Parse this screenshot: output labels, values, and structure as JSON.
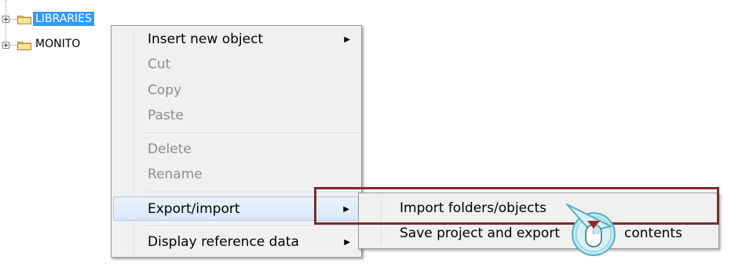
{
  "tree": {
    "items": [
      {
        "label": "LIBRARIES",
        "selected": true
      },
      {
        "label": "MONITO",
        "selected": false
      }
    ]
  },
  "context_menu": {
    "items": [
      {
        "label": "Insert new object",
        "has_submenu": true,
        "disabled": false
      },
      {
        "label": "Cut",
        "disabled": true
      },
      {
        "label": "Copy",
        "disabled": true
      },
      {
        "label": "Paste",
        "disabled": true
      },
      {
        "label": "Delete",
        "disabled": true
      },
      {
        "label": "Rename",
        "disabled": true
      },
      {
        "label": "Export/import",
        "has_submenu": true,
        "disabled": false,
        "hovered": true
      },
      {
        "label": "Display reference data",
        "has_submenu": true,
        "disabled": false
      }
    ]
  },
  "submenu": {
    "items": [
      {
        "label": "Import folders/objects"
      },
      {
        "label": "Save project and export"
      },
      {
        "label": "contents"
      }
    ]
  },
  "colors": {
    "selection": "#3399ff",
    "highlight_frame": "#7b2c2c",
    "menu_bg": "#f0f0f0",
    "disabled_text": "#8d8d8d"
  },
  "icons": {
    "expand": "plus-box-icon",
    "folder": "folder-icon",
    "submenu_arrow": "triangle-right-icon",
    "cursor": "mouse-click-icon"
  }
}
